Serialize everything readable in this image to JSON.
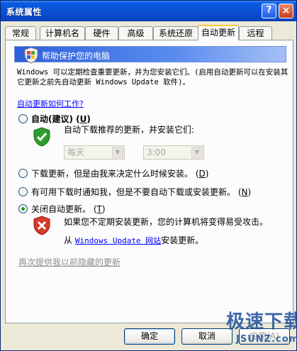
{
  "window": {
    "title": "系统属性"
  },
  "titlebar": {
    "help_glyph": "?",
    "close_glyph": "×"
  },
  "tabs": [
    {
      "label": "常规"
    },
    {
      "label": "计算机名"
    },
    {
      "label": "硬件"
    },
    {
      "label": "高级"
    },
    {
      "label": "系统还原"
    },
    {
      "label": "自动更新",
      "active": true
    },
    {
      "label": "远程"
    }
  ],
  "header": {
    "title": "帮助保护您的电脑"
  },
  "description": "Windows 可以定期检查重要更新，并为您安装它们。(启用自动更新可以在安装其它更新之前先自动更新 Windows Update 软件)。",
  "how_link": "自动更新如何工作?",
  "options": {
    "auto": {
      "label": "自动(建议)",
      "key": "U",
      "sub": "自动下载推荐的更新，并安装它们:",
      "checked": false
    },
    "download": {
      "label": "下载更新，但是由我来决定什么时候安装。",
      "key": "D",
      "checked": false
    },
    "notify": {
      "label": "有可用下载时通知我，但是不要自动下载或安装更新。",
      "key": "N",
      "checked": false
    },
    "off": {
      "label": "关闭自动更新。",
      "key": "T",
      "checked": true,
      "warning": "如果您不定期安装更新，您的计算机将变得易受攻击。",
      "from_prefix": "从",
      "from_link": "Windows Update 网站",
      "from_suffix": "安装更新。"
    }
  },
  "schedule": {
    "day": "每天",
    "time": "3:00"
  },
  "hidden_updates_link": "再次提供我以前隐藏的更新",
  "buttons": {
    "ok": "确定",
    "cancel": "取消",
    "apply": "应用(A)"
  },
  "watermark": {
    "big": "极速下载",
    "small": "JSUNZ.com"
  },
  "colors": {
    "accent": "#0a4fd4",
    "link": "#0000ff",
    "active_tab": "#ffc83c"
  }
}
